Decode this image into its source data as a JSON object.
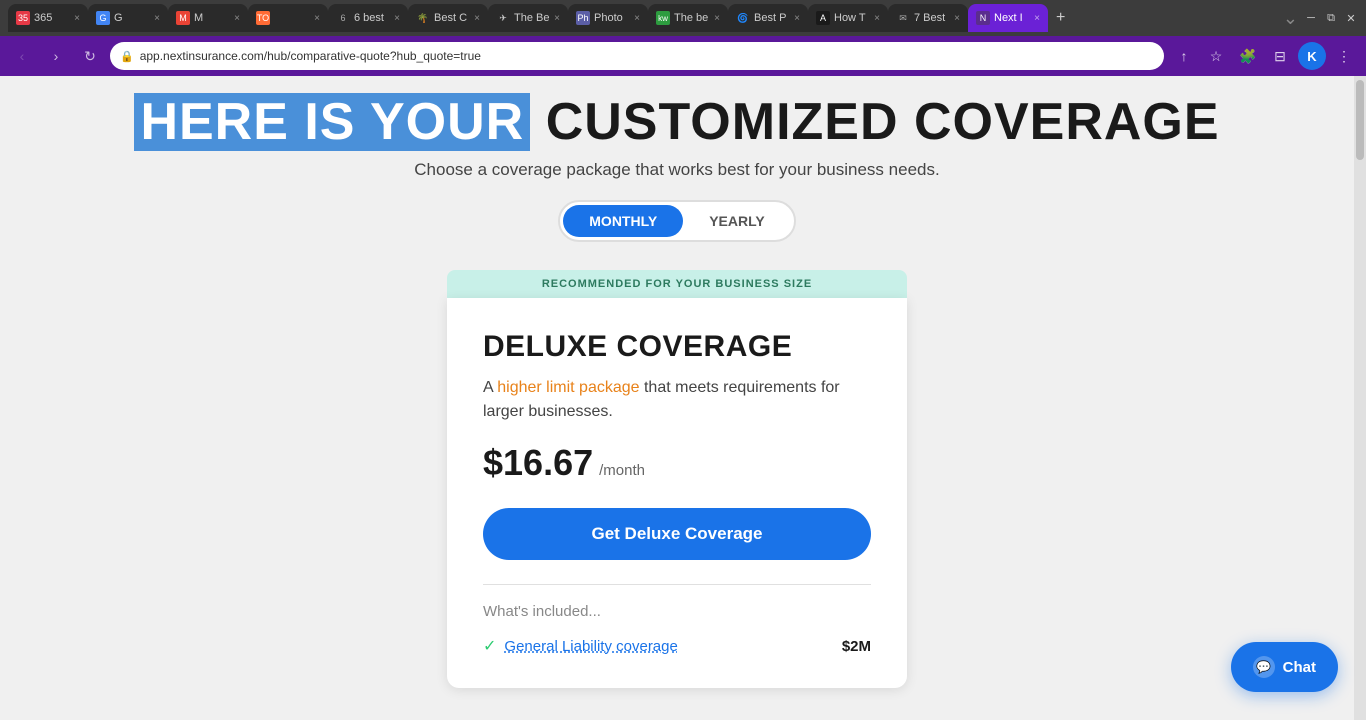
{
  "browser": {
    "url": "app.nextinsurance.com/hub/comparative-quote?hub_quote=true",
    "profile_letter": "K",
    "tabs": [
      {
        "id": "t1",
        "label": "365",
        "favicon": "365",
        "active": false
      },
      {
        "id": "t2",
        "label": "G",
        "favicon": "G",
        "active": false
      },
      {
        "id": "t3",
        "label": "M",
        "favicon": "M",
        "active": false
      },
      {
        "id": "t4",
        "label": "TO",
        "favicon": "TO",
        "active": false
      },
      {
        "id": "t5",
        "label": "6 best",
        "favicon": "6",
        "active": false
      },
      {
        "id": "t6",
        "label": "Best C",
        "favicon": "🌴",
        "active": false
      },
      {
        "id": "t7",
        "label": "The Be",
        "favicon": "✈",
        "active": false
      },
      {
        "id": "t8",
        "label": "Photo",
        "favicon": "📷",
        "active": false
      },
      {
        "id": "t9",
        "label": "The be",
        "favicon": "kw",
        "active": false
      },
      {
        "id": "t10",
        "label": "Best P",
        "favicon": "🌀",
        "active": false
      },
      {
        "id": "t11",
        "label": "How T",
        "favicon": "A",
        "active": false
      },
      {
        "id": "t12",
        "label": "7 Best",
        "favicon": "✉",
        "active": false
      },
      {
        "id": "t13",
        "label": "Next I",
        "favicon": "N",
        "active": true
      }
    ]
  },
  "page": {
    "heading_part1": "HERE IS YOUR",
    "heading_part2": "CUSTOMIZED COVERAGE",
    "subtitle": "Choose a coverage package that works best for your business needs.",
    "toggle": {
      "monthly_label": "MONTHLY",
      "yearly_label": "YEARLY",
      "active": "monthly"
    },
    "recommended_banner": "RECOMMENDED FOR YOUR BUSINESS SIZE",
    "coverage": {
      "title": "DELUXE COVERAGE",
      "description_plain": "A ",
      "description_highlight": "higher limit package",
      "description_rest": " that meets requirements for larger businesses.",
      "price": "$16.67",
      "price_period": "/month",
      "cta_label": "Get Deluxe Coverage",
      "whats_included_label": "What's included...",
      "items": [
        {
          "label": "General Liability coverage",
          "value": "$2M"
        }
      ]
    }
  },
  "chat": {
    "label": "Chat",
    "icon": "💬"
  }
}
